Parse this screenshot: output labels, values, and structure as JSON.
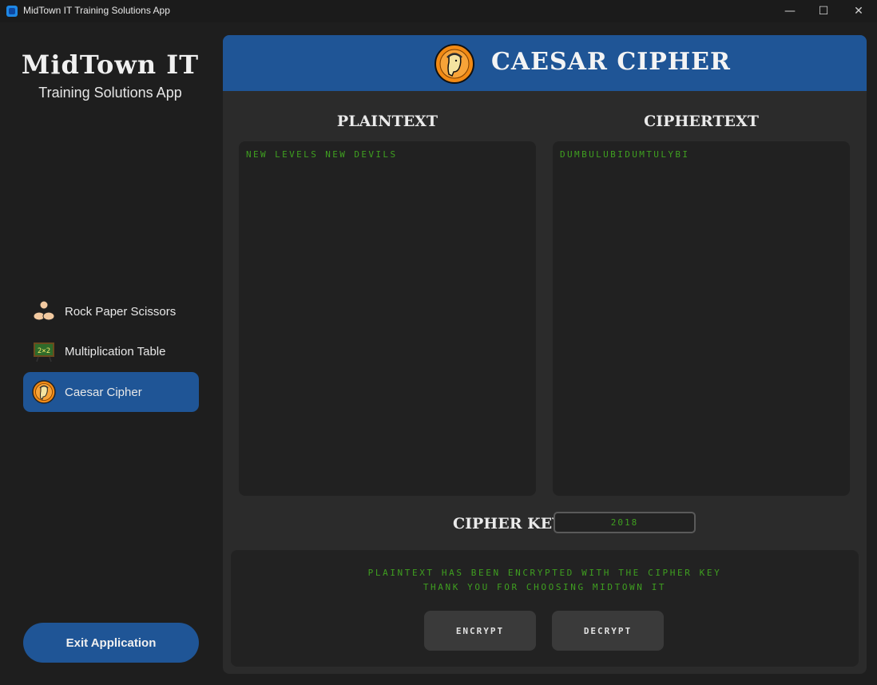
{
  "window": {
    "title": "MidTown IT Training Solutions App",
    "controls": {
      "minimize": "—",
      "maximize": "☐",
      "close": "✕"
    }
  },
  "sidebar": {
    "brand_title": "MidTown IT",
    "brand_subtitle": "Training Solutions App",
    "items": [
      {
        "label": "Rock Paper Scissors",
        "icon": "hands-icon",
        "active": false
      },
      {
        "label": "Multiplication Table",
        "icon": "chalkboard-icon",
        "active": false
      },
      {
        "label": "Caesar Cipher",
        "icon": "caesar-coin-icon",
        "active": true
      }
    ],
    "exit_label": "Exit Application"
  },
  "header": {
    "title": "CAESAR CIPHER",
    "logo_icon": "caesar-coin-icon"
  },
  "plaintext": {
    "label": "PLAINTEXT",
    "value": "NEW LEVELS NEW DEVILS"
  },
  "ciphertext": {
    "label": "CIPHERTEXT",
    "value": "DUMBULUBIDUMTULYBI"
  },
  "cipher_key": {
    "label": "CIPHER KEY:",
    "value": "2018"
  },
  "status": {
    "line1": "PLAINTEXT HAS BEEN ENCRYPTED WITH THE CIPHER KEY",
    "line2": "THANK YOU FOR CHOOSING MIDTOWN IT"
  },
  "buttons": {
    "encrypt": "ENCRYPT",
    "decrypt": "DECRYPT"
  },
  "colors": {
    "accent": "#1f5596",
    "text_green": "#3f9f20",
    "panel": "#2b2b2b",
    "background": "#1e1e1e"
  }
}
